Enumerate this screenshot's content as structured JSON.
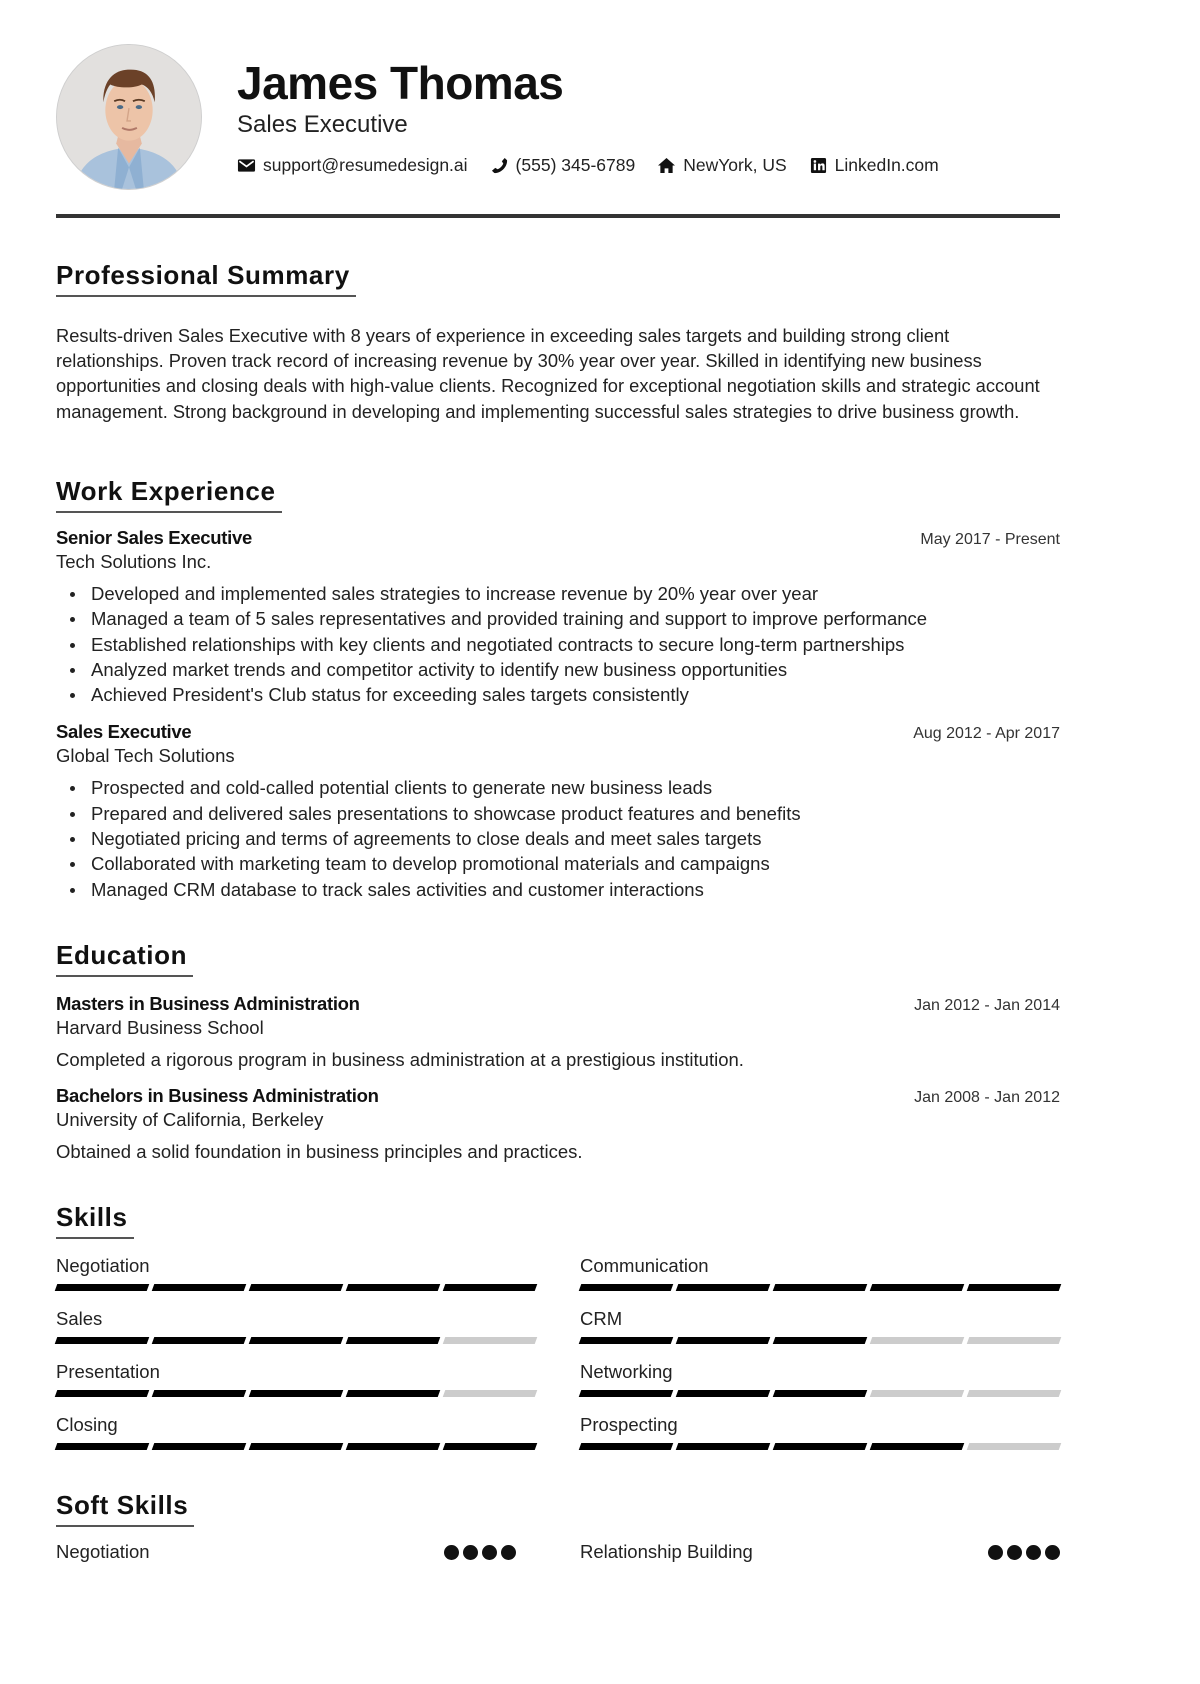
{
  "header": {
    "name": "James Thomas",
    "title": "Sales Executive",
    "contacts": [
      {
        "icon": "envelope-icon",
        "text": "support@resumedesign.ai"
      },
      {
        "icon": "phone-icon",
        "text": "(555) 345-6789"
      },
      {
        "icon": "home-icon",
        "text": "NewYork, US"
      },
      {
        "icon": "linkedin-icon",
        "text": "LinkedIn.com"
      }
    ]
  },
  "summary": {
    "heading": "Professional Summary",
    "text": "Results-driven Sales Executive with 8 years of experience in exceeding sales targets and building strong client relationships. Proven track record of increasing revenue by 30% year over year. Skilled in identifying new business opportunities and closing deals with high-value clients. Recognized for exceptional negotiation skills and strategic account management. Strong background in developing and implementing successful sales strategies to drive business growth."
  },
  "work": {
    "heading": "Work Experience",
    "jobs": [
      {
        "title": "Senior Sales Executive",
        "company": "Tech Solutions Inc.",
        "dates": "May 2017 - Present",
        "bullets": [
          "Developed and implemented sales strategies to increase revenue by 20% year over year",
          "Managed a team of 5 sales representatives and provided training and support to improve performance",
          "Established relationships with key clients and negotiated contracts to secure long-term partnerships",
          "Analyzed market trends and competitor activity to identify new business opportunities",
          "Achieved President's Club status for exceeding sales targets consistently"
        ]
      },
      {
        "title": "Sales Executive",
        "company": "Global Tech Solutions",
        "dates": "Aug 2012 - Apr 2017",
        "bullets": [
          "Prospected and cold-called potential clients to generate new business leads",
          "Prepared and delivered sales presentations to showcase product features and benefits",
          "Negotiated pricing and terms of agreements to close deals and meet sales targets",
          "Collaborated with marketing team to develop promotional materials and campaigns",
          "Managed CRM database to track sales activities and customer interactions"
        ]
      }
    ]
  },
  "education": {
    "heading": "Education",
    "entries": [
      {
        "degree": "Masters in Business Administration",
        "school": "Harvard Business School",
        "dates": "Jan 2012 - Jan 2014",
        "description": "Completed a rigorous program in business administration at a prestigious institution."
      },
      {
        "degree": "Bachelors in Business Administration",
        "school": "University of California, Berkeley",
        "dates": "Jan 2008 - Jan 2012",
        "description": "Obtained a solid foundation in business principles and practices."
      }
    ]
  },
  "skills": {
    "heading": "Skills",
    "max_level": 5,
    "items": [
      {
        "name": "Negotiation",
        "level": 5
      },
      {
        "name": "Communication",
        "level": 5
      },
      {
        "name": "Sales",
        "level": 4
      },
      {
        "name": "CRM",
        "level": 3
      },
      {
        "name": "Presentation",
        "level": 4
      },
      {
        "name": "Networking",
        "level": 3
      },
      {
        "name": "Closing",
        "level": 5
      },
      {
        "name": "Prospecting",
        "level": 4
      }
    ]
  },
  "soft_skills": {
    "heading": "Soft Skills",
    "max_level": 4,
    "items": [
      {
        "name": "Negotiation",
        "level": 4
      },
      {
        "name": "Relationship Building",
        "level": 4
      }
    ]
  },
  "colors": {
    "text": "#222222",
    "heading": "#111111",
    "rule": "#333333",
    "skill_on": "#000000",
    "skill_off": "#cccccc"
  }
}
